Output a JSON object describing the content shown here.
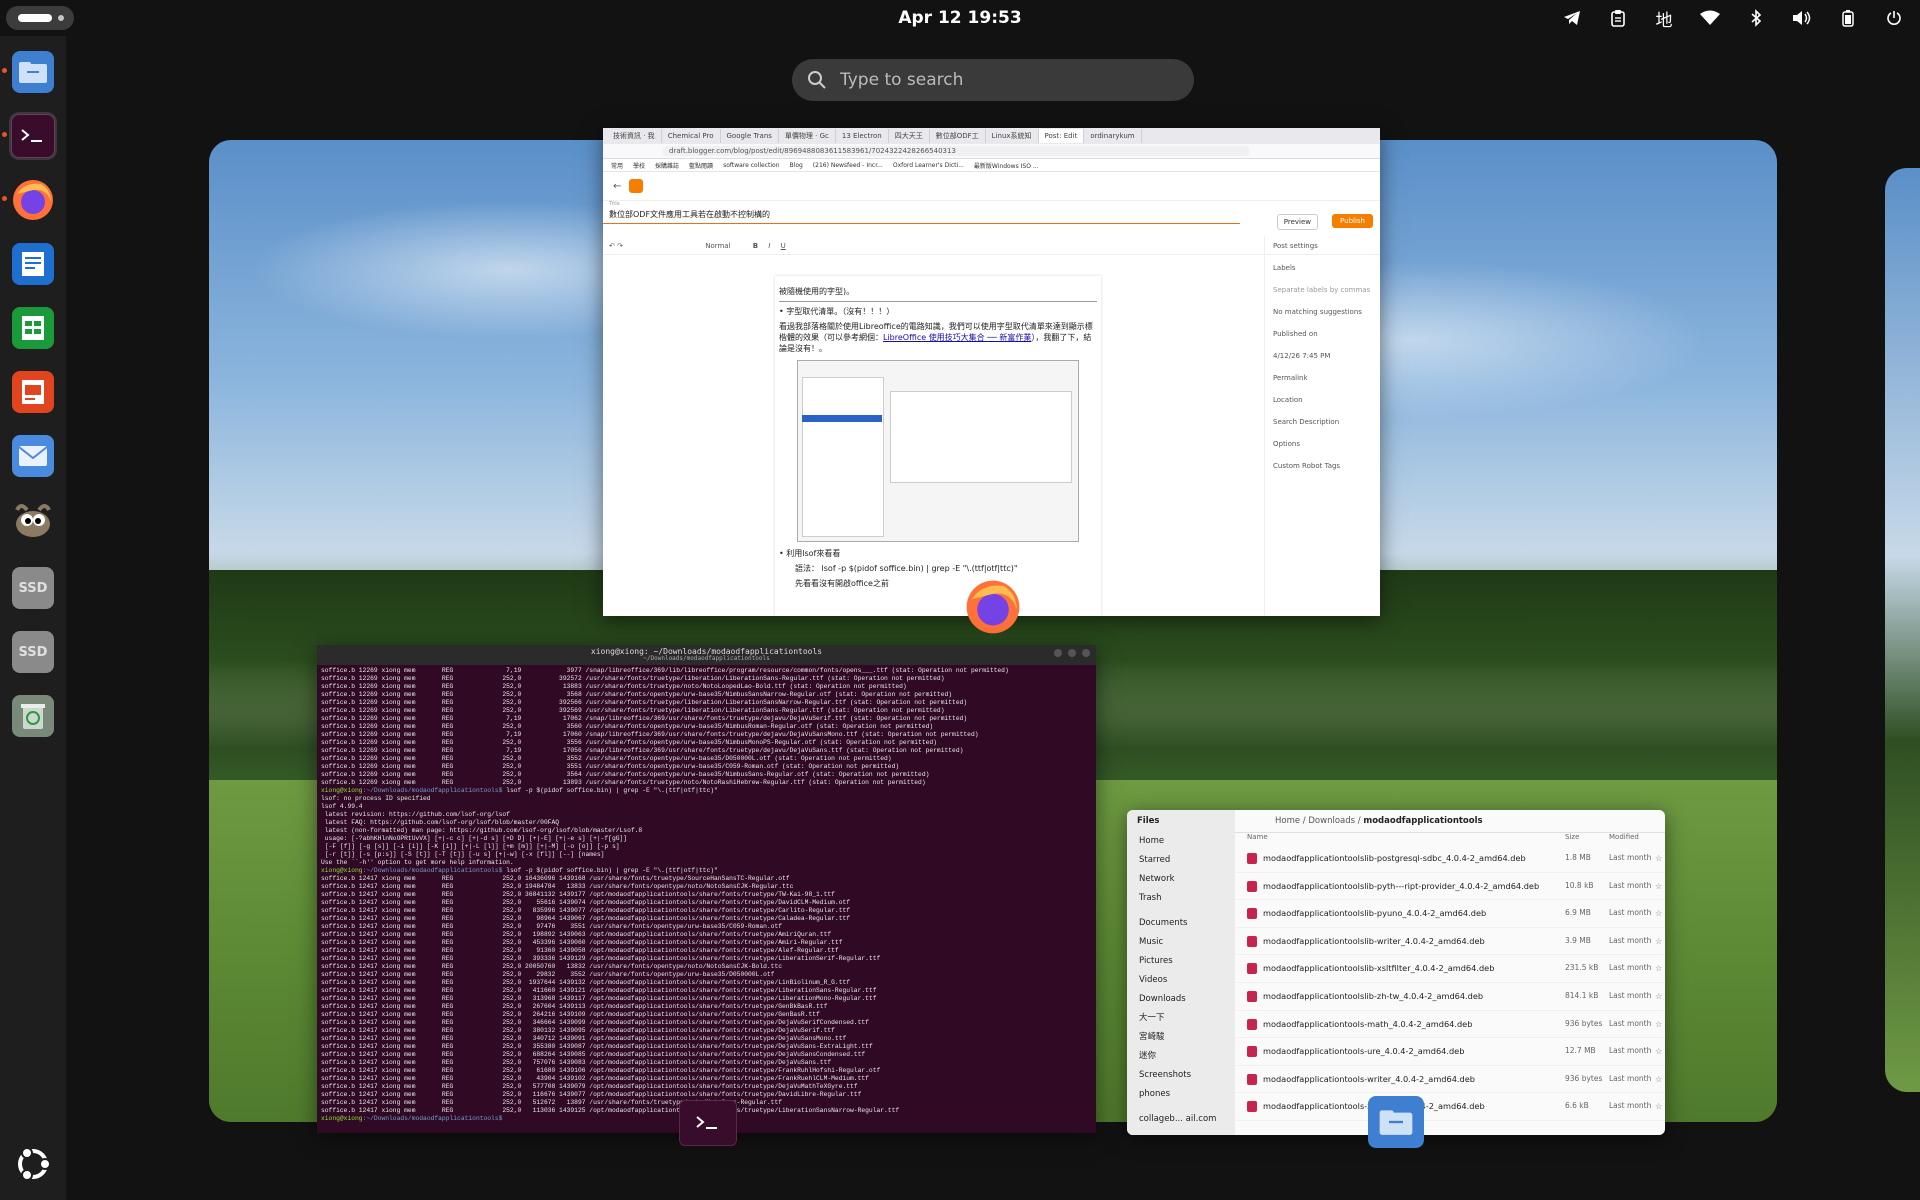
{
  "topbar": {
    "clock": "Apr 12  19:53",
    "input_method": "地"
  },
  "search": {
    "placeholder": "Type to search"
  },
  "dock": {
    "items": [
      "files",
      "terminal",
      "firefox",
      "writer",
      "calc",
      "impress",
      "mail",
      "gimp",
      "ssd-1",
      "ssd-2",
      "trash"
    ],
    "ssd_label": "SSD"
  },
  "browser": {
    "tabs": [
      "技術資訊 · 我",
      "Chemical Pro",
      "Google Trans",
      "單價物理 · Gc",
      "13 Electron",
      "四大天王",
      "數位部ODF工",
      "Linux系統知",
      "Post: Edit",
      "ordinarykum"
    ],
    "url": "draft.blogger.com/blog/post/edit/8969488083611583961/7024322428266540313",
    "bookmarks": [
      "常用",
      "學校",
      "採購雜誌",
      "藍點閱讀",
      "software collection",
      "Blog",
      "(216) Newsfeed - Incr...",
      "Oxford Learner's Dicti...",
      "最新版Windows ISO ..."
    ],
    "post_title_label": "Title",
    "post_title": "數位部ODF文件應用工具若在啟動不控制構的",
    "preview": "Preview",
    "publish": "Publish",
    "style": "Normal",
    "body": {
      "line0": "被隨機使用的字型)。",
      "bullet1": "字型取代清單。（沒有！！！）",
      "para1": "看過我部落格關於使用Libreoffice的電路知識，我們可以使用字型取代清單來達到顯示標楷體的效果（可以參考網個：",
      "link1": "LibreOffice 使用技巧大集合 ── 新富作業",
      "para1_end": "），我翻了下，結論是沒有！。",
      "bullet2": "利用lsof來看看",
      "syntax": "語法： lsof -p $(pidof soffice.bin) | grep -E \"\\.(ttf|otf|ttc)\"",
      "note": "先看看沒有開啟office之前"
    },
    "side": {
      "post_settings": "Post settings",
      "labels": "Labels",
      "labels_hint": "Separate labels by commas",
      "no_match": "No matching suggestions",
      "published_on": "Published on",
      "published_date": "4/12/26 7:45 PM",
      "permalink": "Permalink",
      "location": "Location",
      "search_description": "Search Description",
      "options": "Options",
      "custom_robot_tags": "Custom Robot Tags"
    }
  },
  "terminal": {
    "title": "xiong@xiong: ~/Downloads/modaodfapplicationtools",
    "subtitle": "~/Downloads/modaodfapplicationtools",
    "prompt": "xiong@xiong",
    "cwd": ":~/Downloads/modaodfapplicationtools$",
    "cmd": " lsof -p $(pidof soffice.bin) | grep -E \"\\.(ttf|otf|ttc)\"",
    "lines1": [
      "soffice.b 12269 xiong mem       REG              7,19            3977 /snap/libreoffice/369/lib/libreoffice/program/resource/common/fonts/opens___.ttf (stat: Operation not permitted)",
      "soffice.b 12269 xiong mem       REG             252,0          392572 /usr/share/fonts/truetype/liberation/LiberationSans-Regular.ttf (stat: Operation not permitted)",
      "soffice.b 12269 xiong mem       REG             252,0           13883 /usr/share/fonts/truetype/noto/NotoLoopedLao-Bold.ttf (stat: Operation not permitted)",
      "soffice.b 12269 xiong mem       REG             252,0            3568 /usr/share/fonts/opentype/urw-base35/NimbusSansNarrow-Regular.otf (stat: Operation not permitted)",
      "soffice.b 12269 xiong mem       REG             252,0          392566 /usr/share/fonts/truetype/liberation/LiberationSansNarrow-Regular.ttf (stat: Operation not permitted)",
      "soffice.b 12269 xiong mem       REG             252,0          392569 /usr/share/fonts/truetype/liberation/LiberationSans-Regular.ttf (stat: Operation not permitted)",
      "soffice.b 12269 xiong mem       REG              7,19           17062 /snap/libreoffice/369/usr/share/fonts/truetype/dejavu/DejaVuSerif.ttf (stat: Operation not permitted)",
      "soffice.b 12269 xiong mem       REG             252,0            3560 /usr/share/fonts/opentype/urw-base35/NimbusRoman-Regular.otf (stat: Operation not permitted)",
      "soffice.b 12269 xiong mem       REG              7,19           17060 /snap/libreoffice/369/usr/share/fonts/truetype/dejavu/DejaVuSansMono.ttf (stat: Operation not permitted)",
      "soffice.b 12269 xiong mem       REG             252,0            3556 /usr/share/fonts/opentype/urw-base35/NimbusMonoPS-Regular.otf (stat: Operation not permitted)",
      "soffice.b 12269 xiong mem       REG              7,19           17056 /snap/libreoffice/369/usr/share/fonts/truetype/dejavu/DejaVuSans.ttf (stat: Operation not permitted)",
      "soffice.b 12269 xiong mem       REG             252,0            3552 /usr/share/fonts/opentype/urw-base35/D050000L.otf (stat: Operation not permitted)",
      "soffice.b 12269 xiong mem       REG             252,0            3551 /usr/share/fonts/opentype/urw-base35/C059-Roman.otf (stat: Operation not permitted)",
      "soffice.b 12269 xiong mem       REG             252,0            3564 /usr/share/fonts/opentype/urw-base35/NimbusSans-Regular.otf (stat: Operation not permitted)",
      "soffice.b 12269 xiong mem       REG             252,0           13893 /usr/share/fonts/truetype/noto/NotoRashiHebrew-Regular.ttf (stat: Operation not permitted)"
    ],
    "lines2": [
      "lsof: no process ID specified",
      "lsof 4.99.4",
      " latest revision: https://github.com/lsof-org/lsof",
      " latest FAQ: https://github.com/lsof-org/lsof/blob/master/00FAQ",
      " latest (non-formatted) man page: https://github.com/lsof-org/lsof/blob/master/Lsof.8",
      " usage: [-?abhKHlnNoOPRtUvVX] [+|-c c] [+|-d s] [+D D] [+|-E] [+|-e s] [+|-f[gG]]",
      " [-F [f]] [-g [s]] [-i [i]] [-K [i]] [+|-L [l]] [+m [m]] [+|-M] [-o [o]] [-p s]",
      " [-r [t]] [-s [p:s]] [-S [t]] [-T [t]] [-u s] [+|-w] [-x [fl]] [--] [names]",
      "Use the ``-h'' option to get more help information."
    ],
    "lines3": [
      "soffice.b 12417 xiong mem       REG             252,0 16436096 1439168 /usr/share/fonts/truetype/SourceHanSansTC-Regular.otf",
      "soffice.b 12417 xiong mem       REG             252,0 19484784   13833 /usr/share/fonts/opentype/noto/NotoSansCJK-Regular.ttc",
      "soffice.b 12417 xiong mem       REG             252,0 36841132 1439177 /opt/modaodfapplicationtools/share/fonts/truetype/TW-Kai-98_1.ttf",
      "soffice.b 12417 xiong mem       REG             252,0    55616 1439074 /opt/modaodfapplicationtools/share/fonts/truetype/DavidCLM-Medium.otf",
      "soffice.b 12417 xiong mem       REG             252,0   835996 1439077 /opt/modaodfapplicationtools/share/fonts/truetype/Carlito-Regular.ttf",
      "soffice.b 12417 xiong mem       REG             252,0    98964 1439067 /opt/modaodfapplicationtools/share/fonts/truetype/Caladea-Regular.ttf",
      "soffice.b 12417 xiong mem       REG             252,0    97476    3551 /usr/share/fonts/opentype/urw-base35/C059-Roman.otf",
      "soffice.b 12417 xiong mem       REG             252,0   198892 1439063 /opt/modaodfapplicationtools/share/fonts/truetype/AmiriQuran.ttf",
      "soffice.b 12417 xiong mem       REG             252,0   453396 1439060 /opt/modaodfapplicationtools/share/fonts/truetype/Amiri-Regular.ttf",
      "soffice.b 12417 xiong mem       REG             252,0    91360 1439058 /opt/modaodfapplicationtools/share/fonts/truetype/Alef-Regular.ttf",
      "soffice.b 12417 xiong mem       REG             252,0   393336 1439129 /opt/modaodfapplicationtools/share/fonts/truetype/LiberationSerif-Regular.ttf",
      "soffice.b 12417 xiong mem       REG             252,0 20050760   13832 /usr/share/fonts/opentype/noto/NotoSansCJK-Bold.ttc",
      "soffice.b 12417 xiong mem       REG             252,0    29832    3552 /usr/share/fonts/opentype/urw-base35/D050000L.otf",
      "soffice.b 12417 xiong mem       REG             252,0  1937644 1439132 /opt/modaodfapplicationtools/share/fonts/truetype/LinBiolinum_R_G.ttf",
      "soffice.b 12417 xiong mem       REG             252,0   411660 1439121 /opt/modaodfapplicationtools/share/fonts/truetype/LiberationSans-Regular.ttf",
      "soffice.b 12417 xiong mem       REG             252,0   313968 1439117 /opt/modaodfapplicationtools/share/fonts/truetype/LiberationMono-Regular.ttf",
      "soffice.b 12417 xiong mem       REG             252,0   267604 1439113 /opt/modaodfapplicationtools/share/fonts/truetype/GenBkBasR.ttf",
      "soffice.b 12417 xiong mem       REG             252,0   264216 1439109 /opt/modaodfapplicationtools/share/fonts/truetype/GenBasR.ttf",
      "soffice.b 12417 xiong mem       REG             252,0   346664 1439099 /opt/modaodfapplicationtools/share/fonts/truetype/DejaVuSerifCondensed.ttf",
      "soffice.b 12417 xiong mem       REG             252,0   380132 1439095 /opt/modaodfapplicationtools/share/fonts/truetype/DejaVuSerif.ttf",
      "soffice.b 12417 xiong mem       REG             252,0   340712 1439091 /opt/modaodfapplicationtools/share/fonts/truetype/DejaVuSansMono.ttf",
      "soffice.b 12417 xiong mem       REG             252,0   355380 1439087 /opt/modaodfapplicationtools/share/fonts/truetype/DejaVuSans-ExtraLight.ttf",
      "soffice.b 12417 xiong mem       REG             252,0   688264 1439085 /opt/modaodfapplicationtools/share/fonts/truetype/DejaVuSansCondensed.ttf",
      "soffice.b 12417 xiong mem       REG             252,0   757076 1439083 /opt/modaodfapplicationtools/share/fonts/truetype/DejaVuSans.ttf",
      "soffice.b 12417 xiong mem       REG             252,0    61680 1439106 /opt/modaodfapplicationtools/share/fonts/truetype/FrankRuhlHofshi-Regular.otf",
      "soffice.b 12417 xiong mem       REG             252,0    43904 1439102 /opt/modaodfapplicationtools/share/fonts/truetype/FrankRuehlCLM-Medium.ttf",
      "soffice.b 12417 xiong mem       REG             252,0   577708 1439079 /opt/modaodfapplicationtools/share/fonts/truetype/DejaVuMathTeXGyre.ttf",
      "soffice.b 12417 xiong mem       REG             252,0   116676 1439077 /opt/modaodfapplicationtools/share/fonts/truetype/DavidLibre-Regular.ttf",
      "soffice.b 12417 xiong mem       REG             252,0   512672   13897 /usr/share/fonts/truetype/noto/NotoSans-Regular.ttf",
      "soffice.b 12417 xiong mem       REG             252,0   113036 1439125 /opt/modaodfapplicationtools/share/fonts/truetype/LiberationSansNarrow-Regular.ttf"
    ]
  },
  "files": {
    "title": "Files",
    "sidebar": [
      "Home",
      "Starred",
      "Network",
      "Trash",
      "Documents",
      "Music",
      "Pictures",
      "Videos",
      "Downloads",
      "大一下",
      "宮崎駿",
      "迷你",
      "Screenshots",
      "phones",
      "collageb... ail.com"
    ],
    "path": [
      "Home",
      "Downloads",
      "modaodfapplicationtools"
    ],
    "columns": {
      "name": "Name",
      "size": "Size",
      "modified": "Modified"
    },
    "rows": [
      {
        "name": "modaodfapplicationtoolslib-postgresql-sdbc_4.0.4-2_amd64.deb",
        "size": "1.8 MB",
        "modified": "Last month"
      },
      {
        "name": "modaodfapplicationtoolslib-pyth---ript-provider_4.0.4-2_amd64.deb",
        "size": "10.8 kB",
        "modified": "Last month"
      },
      {
        "name": "modaodfapplicationtoolslib-pyuno_4.0.4-2_amd64.deb",
        "size": "6.9 MB",
        "modified": "Last month"
      },
      {
        "name": "modaodfapplicationtoolslib-writer_4.0.4-2_amd64.deb",
        "size": "3.9 MB",
        "modified": "Last month"
      },
      {
        "name": "modaodfapplicationtoolslib-xsltfilter_4.0.4-2_amd64.deb",
        "size": "231.5 kB",
        "modified": "Last month"
      },
      {
        "name": "modaodfapplicationtoolslib-zh-tw_4.0.4-2_amd64.deb",
        "size": "814.1 kB",
        "modified": "Last month"
      },
      {
        "name": "modaodfapplicationtools-math_4.0.4-2_amd64.deb",
        "size": "936 bytes",
        "modified": "Last month"
      },
      {
        "name": "modaodfapplicationtools-ure_4.0.4-2_amd64.deb",
        "size": "12.7 MB",
        "modified": "Last month"
      },
      {
        "name": "modaodfapplicationtools-writer_4.0.4-2_amd64.deb",
        "size": "936 bytes",
        "modified": "Last month"
      },
      {
        "name": "modaodfapplicationtools-xsltfilter_4.0.4-2_amd64.deb",
        "size": "6.6 kB",
        "modified": "Last month"
      }
    ]
  }
}
